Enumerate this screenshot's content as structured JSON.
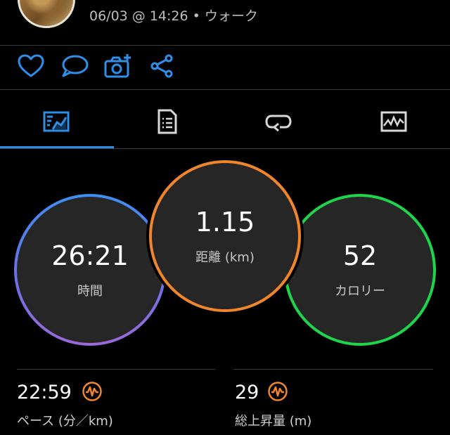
{
  "header": {
    "meta": "06/03 @ 14:26 • ウォーク"
  },
  "actions": [
    {
      "icon": "heart-icon"
    },
    {
      "icon": "comment-icon"
    },
    {
      "icon": "camera-add-icon"
    },
    {
      "icon": "share-icon"
    }
  ],
  "tabs": [
    {
      "icon": "summary-icon",
      "active": true
    },
    {
      "icon": "details-icon",
      "active": false
    },
    {
      "icon": "laps-icon",
      "active": false
    },
    {
      "icon": "charts-icon",
      "active": false
    }
  ],
  "stats": {
    "time": {
      "value": "26:21",
      "label": "時間"
    },
    "distance": {
      "value": "1.15",
      "label": "距離 (km)"
    },
    "calories": {
      "value": "52",
      "label": "カロリー"
    },
    "pace": {
      "value": "22:59",
      "label": "ペース (分／km)"
    },
    "ascent": {
      "value": "29",
      "label": "総上昇量 (m)"
    }
  },
  "colors": {
    "accent": "#2f8fe8",
    "distance_ring": "#f0862c",
    "calories_ring": "#1fd44a",
    "time_ring_top": "#3d8ff2",
    "time_ring_bottom": "#9a6ad8",
    "badge": "#f0862c"
  }
}
